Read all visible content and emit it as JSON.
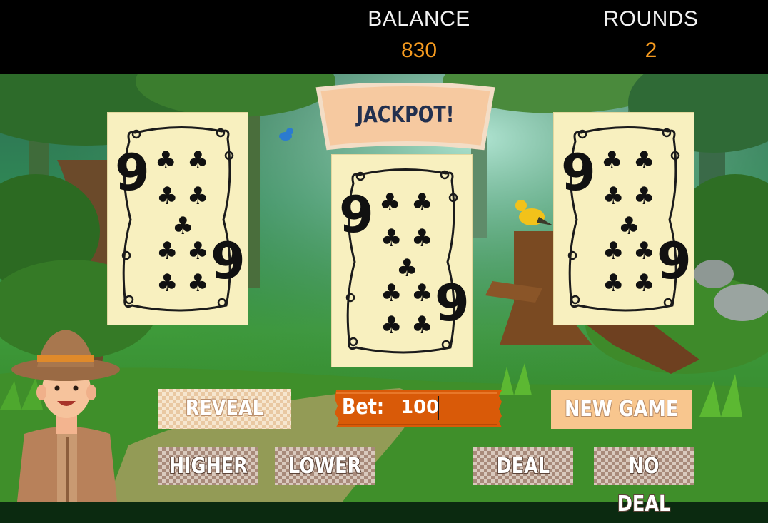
{
  "hud": {
    "balance_label": "BALANCE",
    "balance_value": "830",
    "rounds_label": "ROUNDS",
    "rounds_value": "2"
  },
  "banner": {
    "text": "JACKPOT!"
  },
  "cards": [
    {
      "rank": "9",
      "suit": "clubs"
    },
    {
      "rank": "9",
      "suit": "clubs"
    },
    {
      "rank": "9",
      "suit": "clubs"
    }
  ],
  "bet": {
    "label": "Bet:",
    "value": "100"
  },
  "buttons": {
    "reveal": "REVEAL",
    "new_game": "NEW GAME",
    "higher": "HIGHER",
    "lower": "LOWER",
    "deal": "DEAL",
    "no_deal": "NO DEAL"
  },
  "colors": {
    "hud_value": "#f59a1f",
    "card_face": "#f8f0bf",
    "bet_box": "#d95a08",
    "new_game_button": "#f8c68e"
  }
}
